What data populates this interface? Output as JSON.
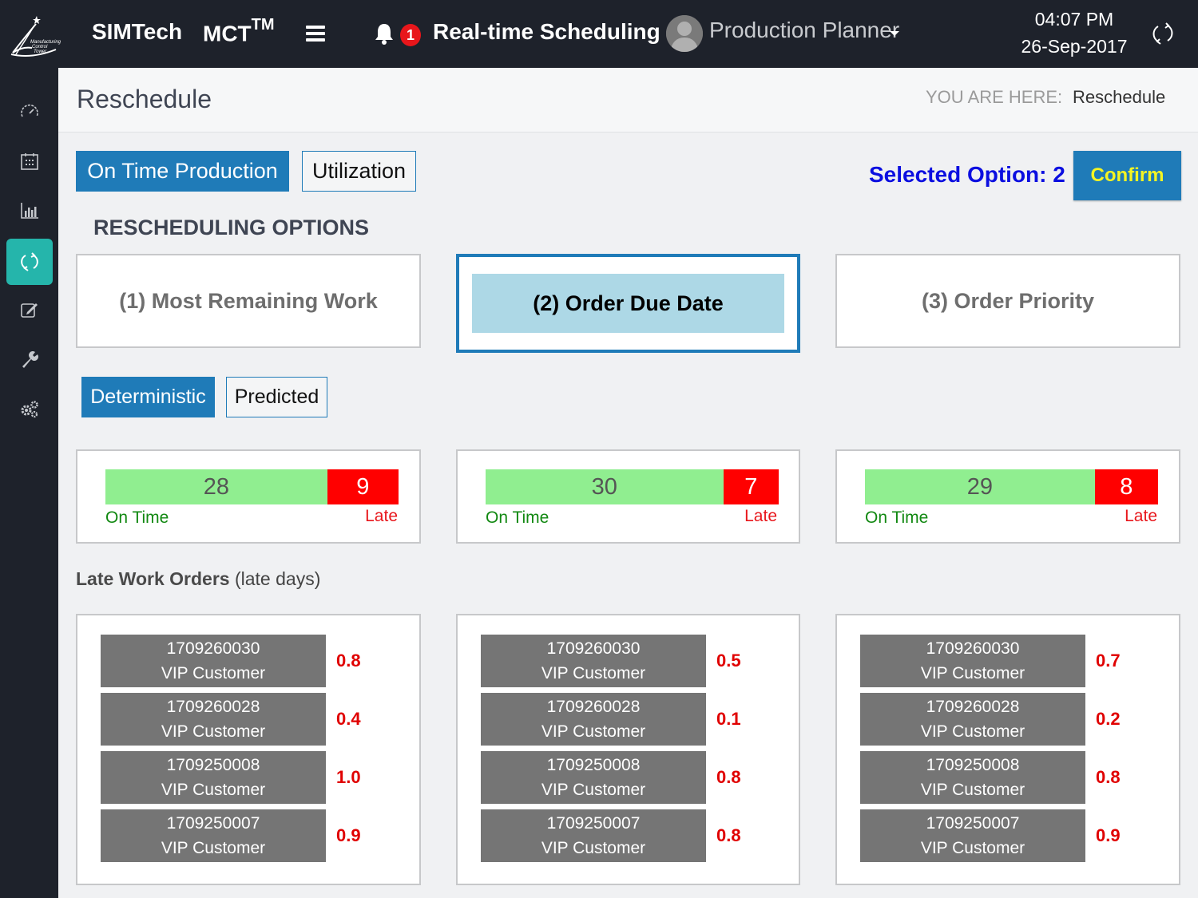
{
  "header": {
    "logo_text": [
      "Manufacturing",
      "Control",
      "Tower"
    ],
    "brand": "SIMTech",
    "product": "MCT",
    "product_sup": "TM",
    "notification_count": "1",
    "app_title": "Real-time Scheduling",
    "user_role": "Production Planner",
    "time": "04:07 PM",
    "date": "26-Sep-2017"
  },
  "sidebar": {
    "items": [
      {
        "icon": "dashboard-gauge-icon",
        "active": false
      },
      {
        "icon": "calendar-icon",
        "active": false
      },
      {
        "icon": "bar-chart-icon",
        "active": false
      },
      {
        "icon": "refresh-icon",
        "active": true
      },
      {
        "icon": "edit-icon",
        "active": false
      },
      {
        "icon": "wrench-icon",
        "active": false
      },
      {
        "icon": "gears-icon",
        "active": false
      }
    ]
  },
  "page": {
    "title": "Reschedule",
    "breadcrumb_label": "YOU ARE HERE:",
    "breadcrumb_current": "Reschedule"
  },
  "tabs": {
    "primary": [
      {
        "label": "On Time Production",
        "active": true
      },
      {
        "label": "Utilization",
        "active": false
      }
    ],
    "mode": [
      {
        "label": "Deterministic",
        "active": true
      },
      {
        "label": "Predicted",
        "active": false
      }
    ]
  },
  "selection": {
    "label": "Selected Option: 2",
    "confirm_label": "Confirm"
  },
  "options_title": "RESCHEDULING OPTIONS",
  "options": [
    {
      "label": "(1) Most Remaining Work",
      "selected": false,
      "on_time": 28,
      "late": 9
    },
    {
      "label": "(2) Order Due Date",
      "selected": true,
      "on_time": 30,
      "late": 7
    },
    {
      "label": "(3) Order Priority",
      "selected": false,
      "on_time": 29,
      "late": 8
    }
  ],
  "summary_labels": {
    "on_time": "On Time",
    "late": "Late"
  },
  "late_orders": {
    "title_bold": "Late Work Orders",
    "title_rest": " (late days)",
    "columns": [
      [
        {
          "id": "1709260030",
          "customer": "VIP Customer",
          "late_days": "0.8"
        },
        {
          "id": "1709260028",
          "customer": "VIP Customer",
          "late_days": "0.4"
        },
        {
          "id": "1709250008",
          "customer": "VIP Customer",
          "late_days": "1.0"
        },
        {
          "id": "1709250007",
          "customer": "VIP Customer",
          "late_days": "0.9"
        }
      ],
      [
        {
          "id": "1709260030",
          "customer": "VIP Customer",
          "late_days": "0.5"
        },
        {
          "id": "1709260028",
          "customer": "VIP Customer",
          "late_days": "0.1"
        },
        {
          "id": "1709250008",
          "customer": "VIP Customer",
          "late_days": "0.8"
        },
        {
          "id": "1709250007",
          "customer": "VIP Customer",
          "late_days": "0.8"
        }
      ],
      [
        {
          "id": "1709260030",
          "customer": "VIP Customer",
          "late_days": "0.7"
        },
        {
          "id": "1709260028",
          "customer": "VIP Customer",
          "late_days": "0.2"
        },
        {
          "id": "1709250008",
          "customer": "VIP Customer",
          "late_days": "0.8"
        },
        {
          "id": "1709250007",
          "customer": "VIP Customer",
          "late_days": "0.9"
        }
      ]
    ]
  },
  "colors": {
    "primary": "#1f7bb8",
    "sidebar_active": "#25b5ab",
    "on_time": "#90ee90",
    "late": "#ff0000",
    "selected_option_bg": "#add8e6",
    "selected_text": "#0b0ee0",
    "confirm_text": "#f4f423"
  }
}
